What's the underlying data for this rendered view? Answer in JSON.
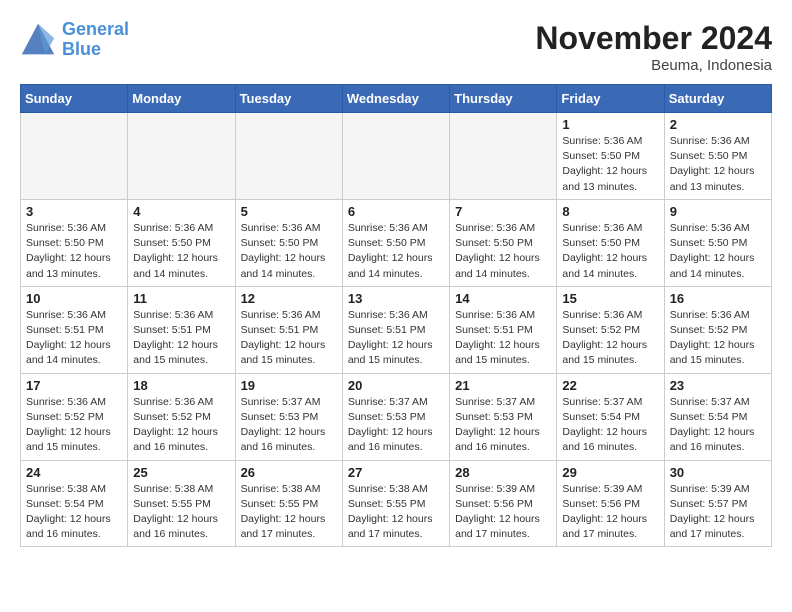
{
  "header": {
    "logo_line1": "General",
    "logo_line2": "Blue",
    "month": "November 2024",
    "location": "Beuma, Indonesia"
  },
  "weekdays": [
    "Sunday",
    "Monday",
    "Tuesday",
    "Wednesday",
    "Thursday",
    "Friday",
    "Saturday"
  ],
  "weeks": [
    [
      {
        "day": "",
        "info": "",
        "empty": true
      },
      {
        "day": "",
        "info": "",
        "empty": true
      },
      {
        "day": "",
        "info": "",
        "empty": true
      },
      {
        "day": "",
        "info": "",
        "empty": true
      },
      {
        "day": "",
        "info": "",
        "empty": true
      },
      {
        "day": "1",
        "info": "Sunrise: 5:36 AM\nSunset: 5:50 PM\nDaylight: 12 hours\nand 13 minutes.",
        "empty": false
      },
      {
        "day": "2",
        "info": "Sunrise: 5:36 AM\nSunset: 5:50 PM\nDaylight: 12 hours\nand 13 minutes.",
        "empty": false
      }
    ],
    [
      {
        "day": "3",
        "info": "Sunrise: 5:36 AM\nSunset: 5:50 PM\nDaylight: 12 hours\nand 13 minutes.",
        "empty": false
      },
      {
        "day": "4",
        "info": "Sunrise: 5:36 AM\nSunset: 5:50 PM\nDaylight: 12 hours\nand 14 minutes.",
        "empty": false
      },
      {
        "day": "5",
        "info": "Sunrise: 5:36 AM\nSunset: 5:50 PM\nDaylight: 12 hours\nand 14 minutes.",
        "empty": false
      },
      {
        "day": "6",
        "info": "Sunrise: 5:36 AM\nSunset: 5:50 PM\nDaylight: 12 hours\nand 14 minutes.",
        "empty": false
      },
      {
        "day": "7",
        "info": "Sunrise: 5:36 AM\nSunset: 5:50 PM\nDaylight: 12 hours\nand 14 minutes.",
        "empty": false
      },
      {
        "day": "8",
        "info": "Sunrise: 5:36 AM\nSunset: 5:50 PM\nDaylight: 12 hours\nand 14 minutes.",
        "empty": false
      },
      {
        "day": "9",
        "info": "Sunrise: 5:36 AM\nSunset: 5:50 PM\nDaylight: 12 hours\nand 14 minutes.",
        "empty": false
      }
    ],
    [
      {
        "day": "10",
        "info": "Sunrise: 5:36 AM\nSunset: 5:51 PM\nDaylight: 12 hours\nand 14 minutes.",
        "empty": false
      },
      {
        "day": "11",
        "info": "Sunrise: 5:36 AM\nSunset: 5:51 PM\nDaylight: 12 hours\nand 15 minutes.",
        "empty": false
      },
      {
        "day": "12",
        "info": "Sunrise: 5:36 AM\nSunset: 5:51 PM\nDaylight: 12 hours\nand 15 minutes.",
        "empty": false
      },
      {
        "day": "13",
        "info": "Sunrise: 5:36 AM\nSunset: 5:51 PM\nDaylight: 12 hours\nand 15 minutes.",
        "empty": false
      },
      {
        "day": "14",
        "info": "Sunrise: 5:36 AM\nSunset: 5:51 PM\nDaylight: 12 hours\nand 15 minutes.",
        "empty": false
      },
      {
        "day": "15",
        "info": "Sunrise: 5:36 AM\nSunset: 5:52 PM\nDaylight: 12 hours\nand 15 minutes.",
        "empty": false
      },
      {
        "day": "16",
        "info": "Sunrise: 5:36 AM\nSunset: 5:52 PM\nDaylight: 12 hours\nand 15 minutes.",
        "empty": false
      }
    ],
    [
      {
        "day": "17",
        "info": "Sunrise: 5:36 AM\nSunset: 5:52 PM\nDaylight: 12 hours\nand 15 minutes.",
        "empty": false
      },
      {
        "day": "18",
        "info": "Sunrise: 5:36 AM\nSunset: 5:52 PM\nDaylight: 12 hours\nand 16 minutes.",
        "empty": false
      },
      {
        "day": "19",
        "info": "Sunrise: 5:37 AM\nSunset: 5:53 PM\nDaylight: 12 hours\nand 16 minutes.",
        "empty": false
      },
      {
        "day": "20",
        "info": "Sunrise: 5:37 AM\nSunset: 5:53 PM\nDaylight: 12 hours\nand 16 minutes.",
        "empty": false
      },
      {
        "day": "21",
        "info": "Sunrise: 5:37 AM\nSunset: 5:53 PM\nDaylight: 12 hours\nand 16 minutes.",
        "empty": false
      },
      {
        "day": "22",
        "info": "Sunrise: 5:37 AM\nSunset: 5:54 PM\nDaylight: 12 hours\nand 16 minutes.",
        "empty": false
      },
      {
        "day": "23",
        "info": "Sunrise: 5:37 AM\nSunset: 5:54 PM\nDaylight: 12 hours\nand 16 minutes.",
        "empty": false
      }
    ],
    [
      {
        "day": "24",
        "info": "Sunrise: 5:38 AM\nSunset: 5:54 PM\nDaylight: 12 hours\nand 16 minutes.",
        "empty": false
      },
      {
        "day": "25",
        "info": "Sunrise: 5:38 AM\nSunset: 5:55 PM\nDaylight: 12 hours\nand 16 minutes.",
        "empty": false
      },
      {
        "day": "26",
        "info": "Sunrise: 5:38 AM\nSunset: 5:55 PM\nDaylight: 12 hours\nand 17 minutes.",
        "empty": false
      },
      {
        "day": "27",
        "info": "Sunrise: 5:38 AM\nSunset: 5:55 PM\nDaylight: 12 hours\nand 17 minutes.",
        "empty": false
      },
      {
        "day": "28",
        "info": "Sunrise: 5:39 AM\nSunset: 5:56 PM\nDaylight: 12 hours\nand 17 minutes.",
        "empty": false
      },
      {
        "day": "29",
        "info": "Sunrise: 5:39 AM\nSunset: 5:56 PM\nDaylight: 12 hours\nand 17 minutes.",
        "empty": false
      },
      {
        "day": "30",
        "info": "Sunrise: 5:39 AM\nSunset: 5:57 PM\nDaylight: 12 hours\nand 17 minutes.",
        "empty": false
      }
    ]
  ]
}
